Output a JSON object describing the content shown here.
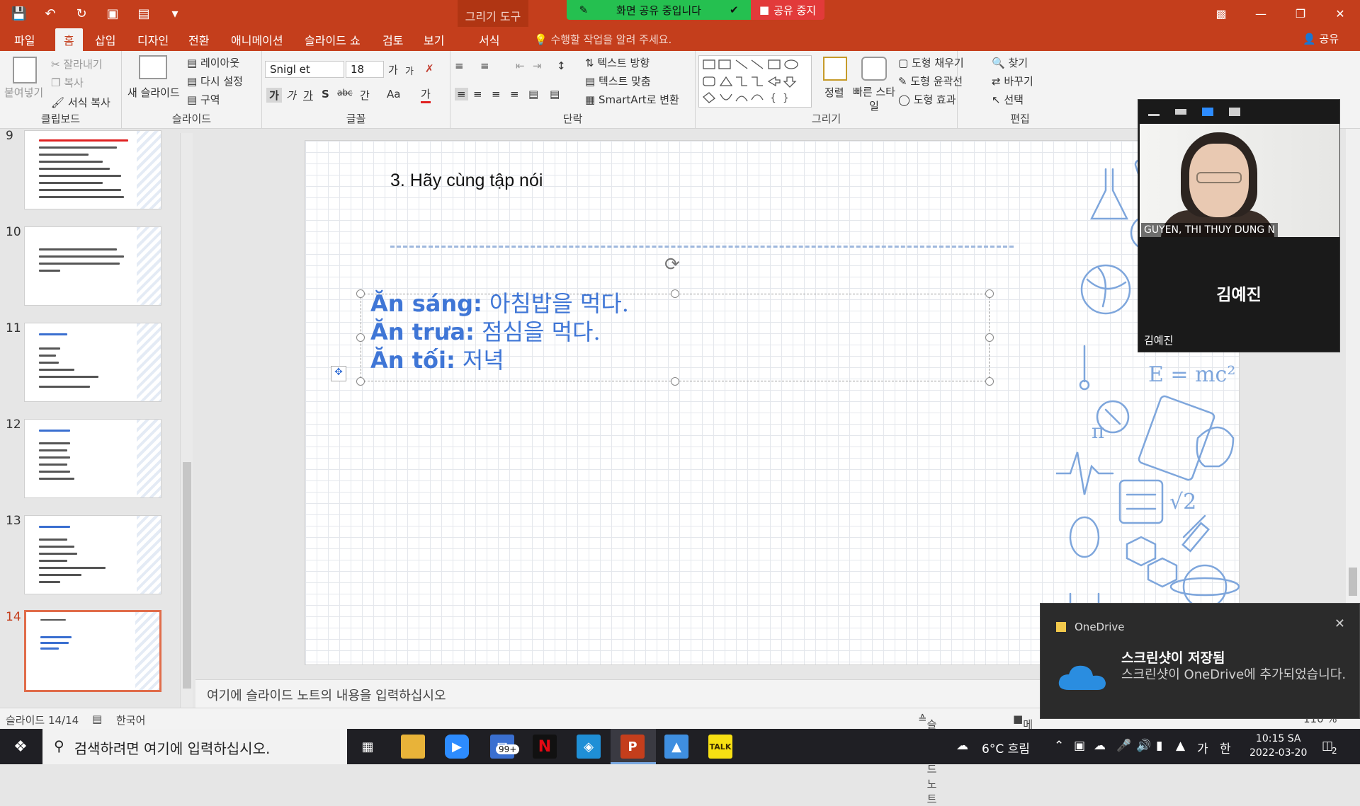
{
  "window": {
    "context_tab": "그리기 도구",
    "share_banner": "화면 공유 중입니다",
    "stop_share": "공유 중지"
  },
  "menu": {
    "tabs": [
      "파일",
      "홈",
      "삽입",
      "디자인",
      "전환",
      "애니메이션",
      "슬라이드 쇼",
      "검토",
      "보기",
      "서식"
    ],
    "active_tab": "홈",
    "tell_me": "수행할 작업을 알려 주세요.",
    "share": "공유"
  },
  "ribbon": {
    "clipboard": {
      "paste": "붙여넣기",
      "cut": "잘라내기",
      "copy": "복사",
      "format_painter": "서식 복사",
      "label": "클립보드"
    },
    "slides": {
      "new_slide": "새 슬라이드",
      "layout": "레이아웃",
      "reset": "다시 설정",
      "section": "구역",
      "label": "슬라이드"
    },
    "font": {
      "font_name": "Snigl et",
      "font_size": "18",
      "grow": "가",
      "shrink": "가",
      "bold": "가",
      "italic": "가",
      "underline": "가",
      "shadow": "S",
      "strike": "abc",
      "spacing": "간",
      "case": "Aa",
      "color": "가",
      "label": "글꼴"
    },
    "paragraph": {
      "text_direction": "텍스트 방향",
      "align_text": "텍스트 맞춤",
      "smartart": "SmartArt로 변환",
      "label": "단락"
    },
    "drawing": {
      "arrange": "정렬",
      "quick_styles": "빠른 스타일",
      "fill": "도형 채우기",
      "outline": "도형 윤곽선",
      "effects": "도형 효과",
      "label": "그리기"
    },
    "editing": {
      "find": "찾기",
      "replace": "바꾸기",
      "select": "선택",
      "label": "편집"
    }
  },
  "thumbnails": [
    {
      "num": "9"
    },
    {
      "num": "10"
    },
    {
      "num": "11"
    },
    {
      "num": "12"
    },
    {
      "num": "13"
    },
    {
      "num": "14",
      "selected": true
    }
  ],
  "slide": {
    "title": "3. Hãy cùng tập nói",
    "lines": [
      {
        "vi": "Ăn sáng:",
        "ko": " 아침밥을 먹다."
      },
      {
        "vi": "Ăn trưa:",
        "ko": " 점심을 먹다."
      },
      {
        "vi": "Ăn tối:",
        "ko": " 저녁"
      }
    ]
  },
  "notes_placeholder": "여기에 슬라이드 노트의 내용을 입력하십시오",
  "status": {
    "slide_counter": "슬라이드 14/14",
    "language": "한국어",
    "notes_btn": "슬라이드 노트",
    "memo_btn": "메모",
    "zoom": "110 %"
  },
  "video": {
    "participant_cam_name": "GUYEN, THI THUY DUNG N",
    "participant_big_name": "김예진",
    "participant_small_name": "김예진"
  },
  "toast": {
    "app": "OneDrive",
    "title": "스크린샷이 저장됨",
    "body": "스크린샷이 OneDrive에 추가되었습니다."
  },
  "taskbar": {
    "search_placeholder": "검색하려면 여기에 입력하십시오.",
    "mail_badge": "99+",
    "weather": "6°C 흐림",
    "ime": "가",
    "ime2": "한",
    "time": "10:15 SA",
    "date": "2022-03-20",
    "notif_count": "2"
  },
  "colors": {
    "accent": "#c43e1c",
    "slide_text": "#3f76d6",
    "zoom_share": "#25c050",
    "stop": "#e23a3a"
  }
}
